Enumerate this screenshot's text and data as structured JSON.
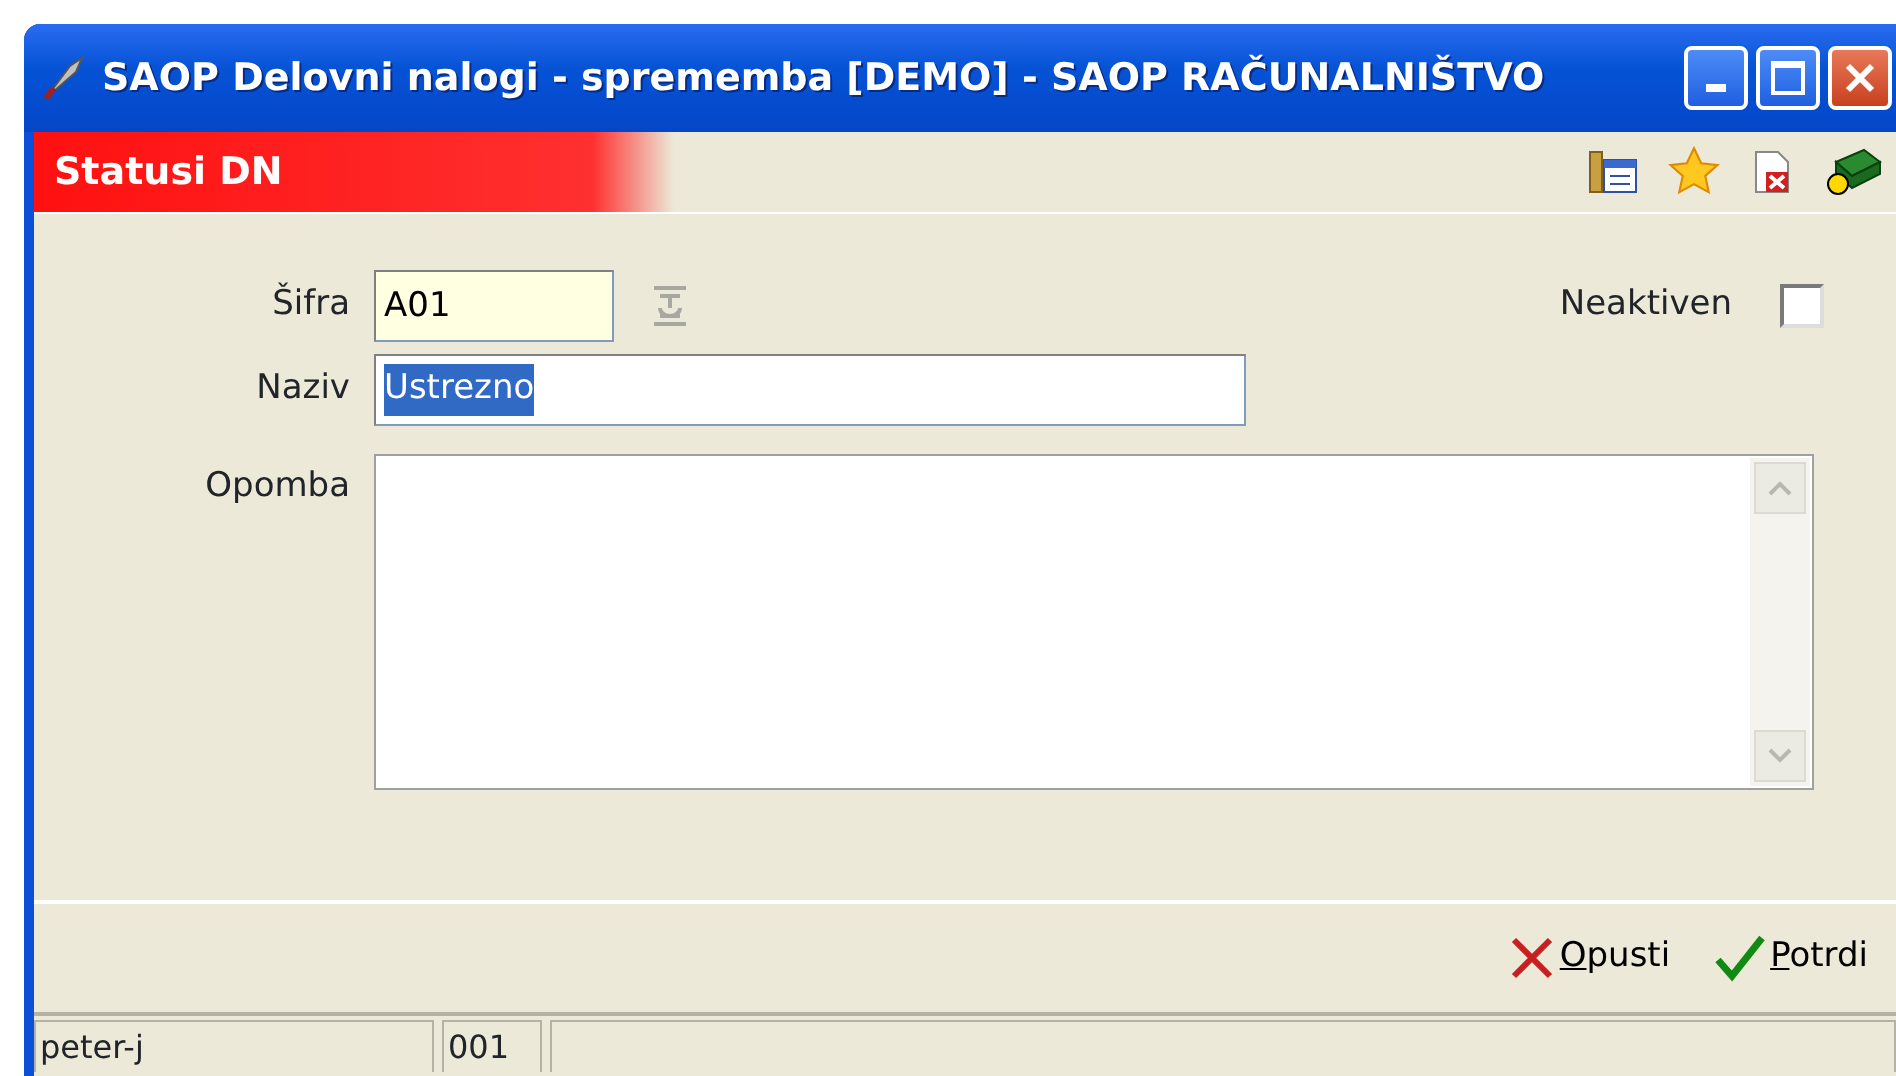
{
  "window": {
    "title": "SAOP Delovni nalogi - sprememba [DEMO] - SAOP RAČUNALNIŠTVO"
  },
  "header": {
    "title": "Statusi DN"
  },
  "form": {
    "sifra": {
      "label": "Šifra",
      "value": "A01"
    },
    "naziv": {
      "label": "Naziv",
      "value": "Ustrezno",
      "text_selected": true
    },
    "opomba": {
      "label": "Opomba"
    },
    "neaktiven": {
      "label": "Neaktiven",
      "checked": false
    }
  },
  "buttons": [
    {
      "kind": "cancel",
      "hotkey": "O",
      "rest": "pusti"
    },
    {
      "kind": "confirm",
      "hotkey": "P",
      "rest": "otrdi"
    }
  ],
  "status_bar": [
    "peter-j",
    "001"
  ]
}
